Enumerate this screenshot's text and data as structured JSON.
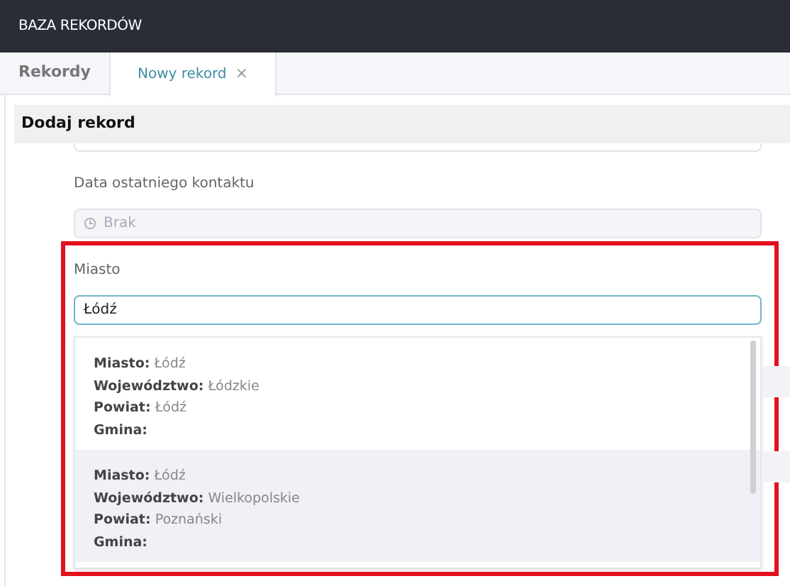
{
  "app_title": "BAZA REKORDÓW",
  "tabs": [
    {
      "label": "Rekordy",
      "selected": false
    },
    {
      "label": "Nowy rekord",
      "selected": true,
      "close": "×"
    }
  ],
  "panel": {
    "title": "Dodaj rekord",
    "fields": [
      {
        "label": "Data ostatniego kontaktu",
        "placeholder": "Brak",
        "disabled": true
      },
      {
        "label": "Miasto",
        "value": "Łódź",
        "focused": true,
        "highlighted": true
      }
    ]
  },
  "suggestions": [
    {
      "selected": false,
      "lines": [
        {
          "label": "Miasto:",
          "value": "Łódź"
        },
        {
          "label": "Województwo:",
          "value": "Łódzkie"
        },
        {
          "label": "Powiat:",
          "value": "Łódź"
        },
        {
          "label": "Gmina:"
        }
      ]
    },
    {
      "selected": true,
      "lines": [
        {
          "label": "Miasto:",
          "value": "Łódź"
        },
        {
          "label": "Województwo:",
          "value": "Wielkopolskie"
        },
        {
          "label": "Powiat:",
          "value": "Poznański"
        },
        {
          "label": "Gmina:"
        }
      ]
    }
  ]
}
